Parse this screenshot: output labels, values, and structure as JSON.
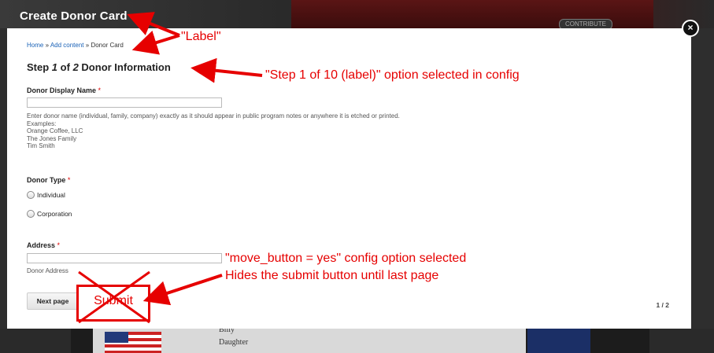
{
  "background": {
    "contribute_label": "CONTRIBUTE",
    "lines": [
      "Billy",
      "Daughter"
    ]
  },
  "page_title": "Create Donor Card",
  "modal": {
    "close_glyph": "×",
    "breadcrumb": {
      "home": "Home",
      "separator": "»",
      "add_content": "Add content",
      "current": "Donor Card"
    },
    "step": {
      "word": "Step",
      "current": "1",
      "of": "of",
      "total": "2",
      "label": "Donor Information"
    },
    "fields": {
      "display_name": {
        "label": "Donor Display Name",
        "required_mark": "*",
        "value": "",
        "description": [
          "Enter donor name (individual, family, company) exactly as it should appear in public program notes or anywhere it is etched or printed.",
          "Examples:",
          "Orange Coffee, LLC",
          "The Jones Family",
          "Tim Smith"
        ]
      },
      "donor_type": {
        "label": "Donor Type",
        "required_mark": "*",
        "options": [
          "Individual",
          "Corporation"
        ]
      },
      "address": {
        "label": "Address",
        "required_mark": "*",
        "value": "",
        "description": "Donor Address"
      }
    },
    "next_button_label": "Next page",
    "page_counter": "1 / 2"
  },
  "annotations": {
    "label_note": "\"Label\"",
    "step_note": "\"Step 1 of 10 (label)\" option selected in config",
    "move_button_note_1": "\"move_button = yes\" config option selected",
    "move_button_note_2": "Hides the submit button until last page",
    "submit_label": "Submit"
  },
  "colors": {
    "annotation_red": "#e60000",
    "link_blue": "#1a62b7",
    "required_red": "#dd0000"
  }
}
